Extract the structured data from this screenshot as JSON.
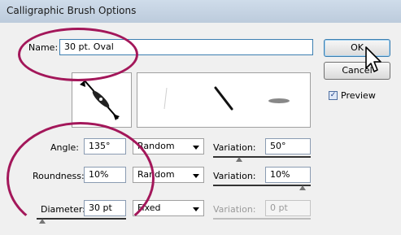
{
  "window": {
    "title": "Calligraphic Brush Options"
  },
  "name_field": {
    "label": "Name:",
    "value": "30 pt. Oval"
  },
  "buttons": {
    "ok": "OK",
    "cancel": "Cancel"
  },
  "preview_checkbox": {
    "label": "Preview",
    "checked": true
  },
  "rows": [
    {
      "label": "Angle:",
      "value": "135°",
      "mode": "Random",
      "variation_label": "Variation:",
      "variation_value": "50°",
      "variation_enabled": true
    },
    {
      "label": "Roundness:",
      "value": "10%",
      "mode": "Random",
      "variation_label": "Variation:",
      "variation_value": "10%",
      "variation_enabled": true
    },
    {
      "label": "Diameter:",
      "value": "30 pt",
      "mode": "Fixed",
      "variation_label": "Variation:",
      "variation_value": "0 pt",
      "variation_enabled": false
    }
  ],
  "colors": {
    "highlight_ring": "#a3175a",
    "dialog_bg": "#f0f0f0"
  }
}
